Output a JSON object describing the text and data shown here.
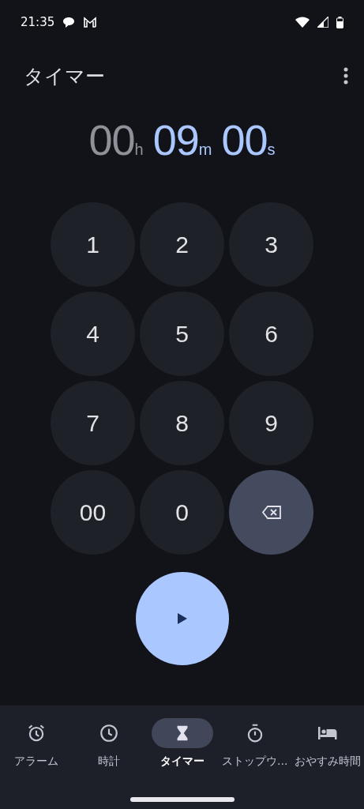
{
  "status_bar": {
    "time": "21:35"
  },
  "app_bar": {
    "title": "タイマー"
  },
  "timer_display": [
    {
      "value": "00",
      "unit": "h",
      "active": false
    },
    {
      "value": "09",
      "unit": "m",
      "active": true
    },
    {
      "value": "00",
      "unit": "s",
      "active": true
    }
  ],
  "keypad": [
    {
      "kind": "digit",
      "label": "1"
    },
    {
      "kind": "digit",
      "label": "2"
    },
    {
      "kind": "digit",
      "label": "3"
    },
    {
      "kind": "digit",
      "label": "4"
    },
    {
      "kind": "digit",
      "label": "5"
    },
    {
      "kind": "digit",
      "label": "6"
    },
    {
      "kind": "digit",
      "label": "7"
    },
    {
      "kind": "digit",
      "label": "8"
    },
    {
      "kind": "digit",
      "label": "9"
    },
    {
      "kind": "digit",
      "label": "00"
    },
    {
      "kind": "digit",
      "label": "0"
    },
    {
      "kind": "backspace"
    }
  ],
  "nav": [
    {
      "kind": "alarm",
      "label": "アラーム",
      "selected": false
    },
    {
      "kind": "clock",
      "label": "時計",
      "selected": false
    },
    {
      "kind": "timer",
      "label": "タイマー",
      "selected": true
    },
    {
      "kind": "stopwatch",
      "label": "ストップウ…",
      "selected": false
    },
    {
      "kind": "bedtime",
      "label": "おやすみ時間",
      "selected": false
    }
  ]
}
